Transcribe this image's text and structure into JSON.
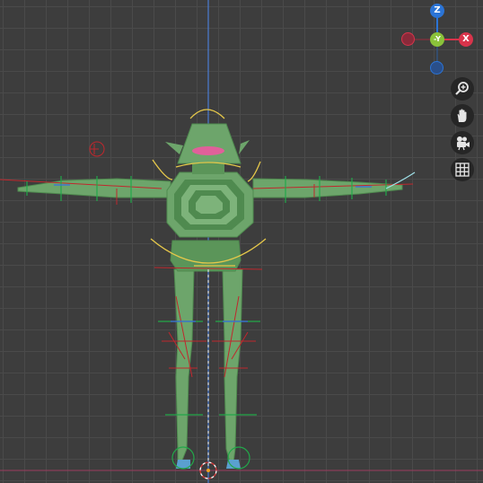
{
  "viewport": {
    "background_color": "#3d3d3d",
    "grid_color": "#4a4a4a",
    "vertical_axis_color": "#4a78c8",
    "ground_axis_color": "#c0506a"
  },
  "character": {
    "body_color": "#6da56b",
    "body_dark_color": "#4f8a4f",
    "mouth_color": "#e0609a",
    "shoe_color": "#5aa0d0",
    "selection_color": "#e6c84a",
    "bone_color": "#c0272d",
    "control_green": "#22a84a",
    "control_blue": "#3a6ee0"
  },
  "gizmo": {
    "z_label": "Z",
    "y_label": "-Y",
    "x_label": "X",
    "neg_x_label": "",
    "neg_z_label": "",
    "z_color": "#2b74d6",
    "y_color": "#8ac23a",
    "x_color": "#d8344b",
    "neg_x_color": "#9b2a3c",
    "neg_z_color": "#2a5d9b"
  },
  "nav_buttons": {
    "zoom_icon": "zoom-icon",
    "pan_icon": "hand-icon",
    "camera_icon": "camera-icon",
    "grid_icon": "grid-icon"
  }
}
